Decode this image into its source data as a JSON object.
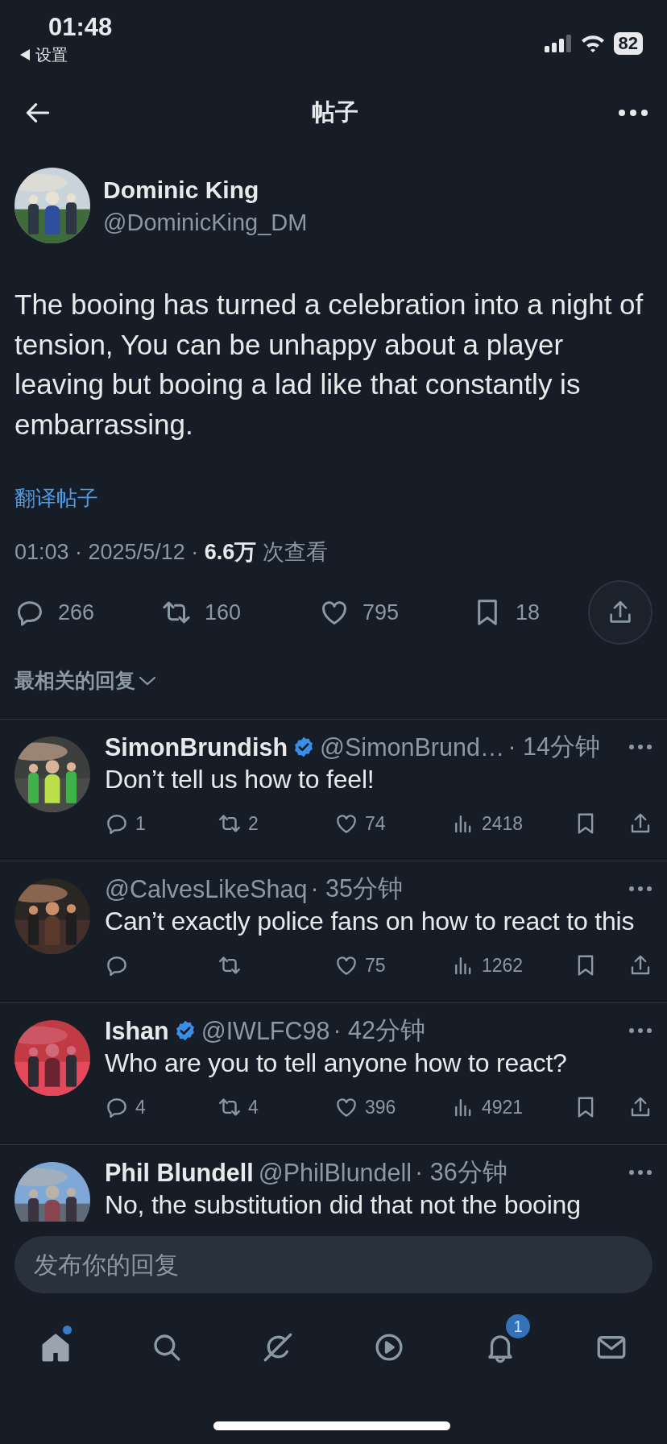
{
  "status_bar": {
    "time": "01:48",
    "back_app": "设置",
    "battery": "82"
  },
  "header": {
    "title": "帖子"
  },
  "post": {
    "author": {
      "name": "Dominic King",
      "handle": "@DominicKing_DM"
    },
    "text": "The booing has turned a celebration into a night of tension, You can be unhappy about a player leaving but booing a lad like that constantly is embarrassing.",
    "translate": "翻译帖子",
    "meta": "01:03 · 2025/5/12 · **6.6万** 次查看",
    "actions": [
      {
        "kind": "reply",
        "count": "266"
      },
      {
        "kind": "repost",
        "count": "160"
      },
      {
        "kind": "like",
        "count": "795"
      },
      {
        "kind": "bookmark",
        "count": "18"
      },
      {
        "kind": "share"
      }
    ]
  },
  "sort": {
    "label": "最相关的回复"
  },
  "replies": [
    {
      "name": "SimonBrundish",
      "verified": true,
      "handle": "@SimonBrund…",
      "time": "· 14分钟",
      "text": "Don’t tell us how to feel!",
      "stats": [
        {
          "kind": "reply",
          "count": "1"
        },
        {
          "kind": "repost",
          "count": "2"
        },
        {
          "kind": "like",
          "count": "74"
        },
        {
          "kind": "views",
          "count": "2418"
        }
      ]
    },
    {
      "verified": false,
      "handle": "@CalvesLikeShaq",
      "time": "· 35分钟",
      "text": "Can’t exactly police fans on how to react to this",
      "stats": [
        {
          "kind": "reply"
        },
        {
          "kind": "repost"
        },
        {
          "kind": "like",
          "count": "75"
        },
        {
          "kind": "views",
          "count": "1262"
        }
      ]
    },
    {
      "name": "Ishan",
      "verified": true,
      "handle": "@IWLFC98",
      "time": "· 42分钟",
      "text": "Who are you to tell anyone how to react?",
      "stats": [
        {
          "kind": "reply",
          "count": "4"
        },
        {
          "kind": "repost",
          "count": "4"
        },
        {
          "kind": "like",
          "count": "396"
        },
        {
          "kind": "views",
          "count": "4921"
        }
      ]
    },
    {
      "name": "Phil Blundell",
      "verified": false,
      "handle": "@PhilBlundell",
      "time": "· 36分钟",
      "text": "No, the substitution did that not the booing"
    }
  ],
  "composer": {
    "placeholder": "发布你的回复"
  },
  "tab_bar": [
    {
      "kind": "home",
      "selected": true,
      "new_dot": true
    },
    {
      "kind": "search",
      "selected": false,
      "new_dot": false
    },
    {
      "kind": "grok",
      "selected": false,
      "new_dot": false
    },
    {
      "kind": "video",
      "selected": false,
      "new_dot": false
    },
    {
      "kind": "notifications",
      "selected": false,
      "new_dot": false,
      "badge": "1"
    },
    {
      "kind": "messages",
      "selected": false,
      "new_dot": false
    }
  ]
}
